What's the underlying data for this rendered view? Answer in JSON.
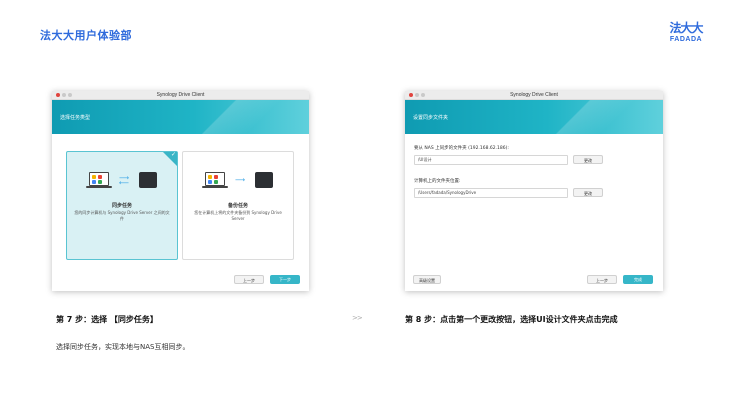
{
  "page_title": "法大大用户体验部",
  "logo": {
    "line1": "法大大",
    "line2": "FADADA"
  },
  "colors": {
    "accent": "#2f6bdc",
    "teal": "#1fb4c6"
  },
  "left_window": {
    "app_title": "Synology Drive Client",
    "banner_title": "选择任务类型",
    "cards": [
      {
        "title": "同步任务",
        "desc": "您的同步计算机与 Synology Drive Server 之间的文件"
      },
      {
        "title": "备份任务",
        "desc": "您在计算机上将的文件夹备份到 Synology Drive Server"
      }
    ],
    "prev_label": "上一步",
    "next_label": "下一步"
  },
  "right_window": {
    "app_title": "Synology Drive Client",
    "banner_title": "设置同步文件夹",
    "nas_label": "要从 NAS 上同步的文件夹 (192.168.62.186):",
    "nas_value": "/UI设计",
    "local_label": "计算机上的文件夹位置:",
    "local_value": "/Users/fadada/SynologyDrive",
    "change_label": "更改",
    "advanced_label": "高级设置",
    "prev_label": "上一步",
    "done_label": "完成"
  },
  "step7": {
    "title": "第 7 步：选择 【同步任务】",
    "desc": "选择同步任务，实现本地与NAS互相同步。"
  },
  "separator": ">>",
  "step8": {
    "title": "第 8 步：点击第一个更改按钮，选择UI设计文件夹点击完成"
  }
}
